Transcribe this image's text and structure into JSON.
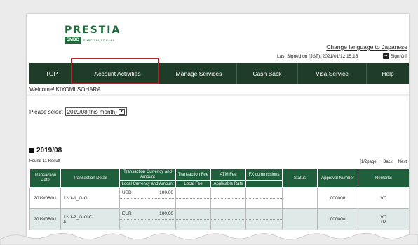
{
  "brand": {
    "name": "PRESTIA",
    "sub_logo": "SMBC",
    "sub_tail": "SMBC TRUST BANK"
  },
  "header": {
    "change_language": "Change language to Japanese",
    "last_signed": "Last Signed on (JST): 2021/01/12 15:15",
    "sign_off": "Sign Off"
  },
  "nav": [
    {
      "label": "TOP"
    },
    {
      "label": "Account Activities"
    },
    {
      "label": "Manage Services"
    },
    {
      "label": "Cash Back"
    },
    {
      "label": "Visa Service"
    },
    {
      "label": "Help"
    }
  ],
  "welcome": "Welcome! KIYOMI SOHARA",
  "period_select": {
    "label": "Please select",
    "value": "2019/08(this month)"
  },
  "period_title": "2019/08",
  "result": {
    "found": "Found 11 Result",
    "page": "[1/2page]",
    "back": "Back",
    "next": "Next"
  },
  "table": {
    "headers": {
      "date": "Transaction Date",
      "detail": "Transaction Detail",
      "currency_amount": "Transaction Currency and Amount",
      "local_amount": "Local Currency and Amount",
      "fee": "Transaction Fee",
      "local_fee": "Local Fee",
      "atm_fee": "ATM Fee",
      "rate": "Applicable Rate",
      "fx": "FX commissions",
      "status": "Status",
      "approval": "Approval Number",
      "remarks": "Remarks"
    },
    "rows": [
      {
        "date": "2019/08/01",
        "detail": "12-1-1_G-G",
        "currency": "USD",
        "amount": "100.00",
        "approval": "000000",
        "remarks": "VC"
      },
      {
        "date": "2019/08/01",
        "detail": "12-1-2_G-G-C",
        "detail2": "A",
        "currency": "EUR",
        "amount": "100.00",
        "approval": "000000",
        "remarks": "VC",
        "remarks2": "02"
      }
    ]
  },
  "colors": {
    "nav_bg": "#1f3c29",
    "table_header": "#1f5f3b",
    "highlight": "#b0272d",
    "brand_green": "#1f6b3b"
  }
}
